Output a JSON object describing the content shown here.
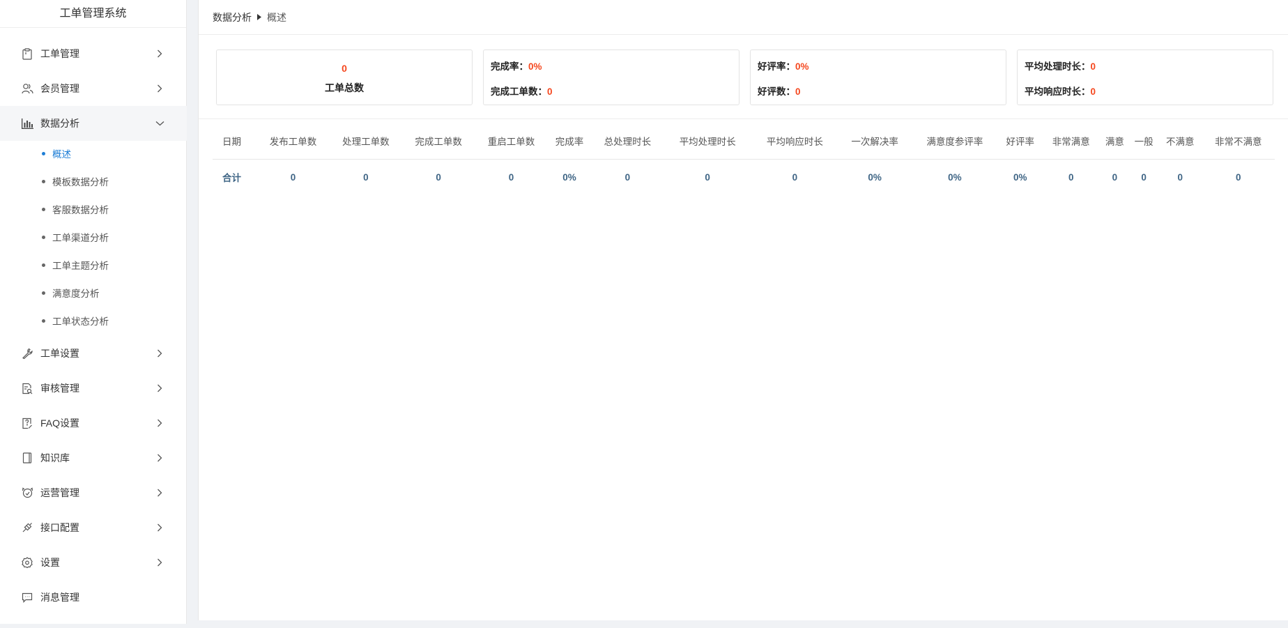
{
  "sidebar": {
    "title": "工单管理系统",
    "items": [
      {
        "label": "工单管理",
        "icon": "clipboard-icon"
      },
      {
        "label": "会员管理",
        "icon": "users-icon"
      },
      {
        "label": "数据分析",
        "icon": "bar-chart-icon",
        "open": true
      },
      {
        "label": "工单设置",
        "icon": "wrench-icon"
      },
      {
        "label": "审核管理",
        "icon": "audit-icon"
      },
      {
        "label": "FAQ设置",
        "icon": "faq-icon"
      },
      {
        "label": "知识库",
        "icon": "book-icon"
      },
      {
        "label": "运营管理",
        "icon": "operations-icon"
      },
      {
        "label": "接口配置",
        "icon": "plug-icon"
      },
      {
        "label": "设置",
        "icon": "gear-icon"
      },
      {
        "label": "消息管理",
        "icon": "message-icon"
      }
    ],
    "submenu": [
      {
        "label": "概述",
        "active": true
      },
      {
        "label": "模板数据分析"
      },
      {
        "label": "客服数据分析"
      },
      {
        "label": "工单渠道分析"
      },
      {
        "label": "工单主题分析"
      },
      {
        "label": "满意度分析"
      },
      {
        "label": "工单状态分析"
      }
    ]
  },
  "breadcrumb": {
    "parent": "数据分析",
    "current": "概述"
  },
  "summary": {
    "total_value": "0",
    "total_label": "工单总数",
    "completion_rate_label": "完成率：",
    "completion_rate_value": "0%",
    "completed_count_label": "完成工单数：",
    "completed_count_value": "0",
    "good_rate_label": "好评率：",
    "good_rate_value": "0%",
    "good_count_label": "好评数：",
    "good_count_value": "0",
    "avg_handle_label": "平均处理时长：",
    "avg_handle_value": "0",
    "avg_response_label": "平均响应时长：",
    "avg_response_value": "0"
  },
  "table": {
    "headers": [
      "日期",
      "发布工单数",
      "处理工单数",
      "完成工单数",
      "重启工单数",
      "完成率",
      "总处理时长",
      "平均处理时长",
      "平均响应时长",
      "一次解决率",
      "满意度参评率",
      "好评率",
      "非常满意",
      "满意",
      "一般",
      "不满意",
      "非常不满意"
    ],
    "rows": [
      [
        "合计",
        "0",
        "0",
        "0",
        "0",
        "0%",
        "0",
        "0",
        "0",
        "0%",
        "0%",
        "0%",
        "0",
        "0",
        "0",
        "0",
        "0"
      ]
    ]
  },
  "colors": {
    "accent": "#1e7ed6",
    "highlight": "#f5471e",
    "table_value": "#3f6585"
  }
}
